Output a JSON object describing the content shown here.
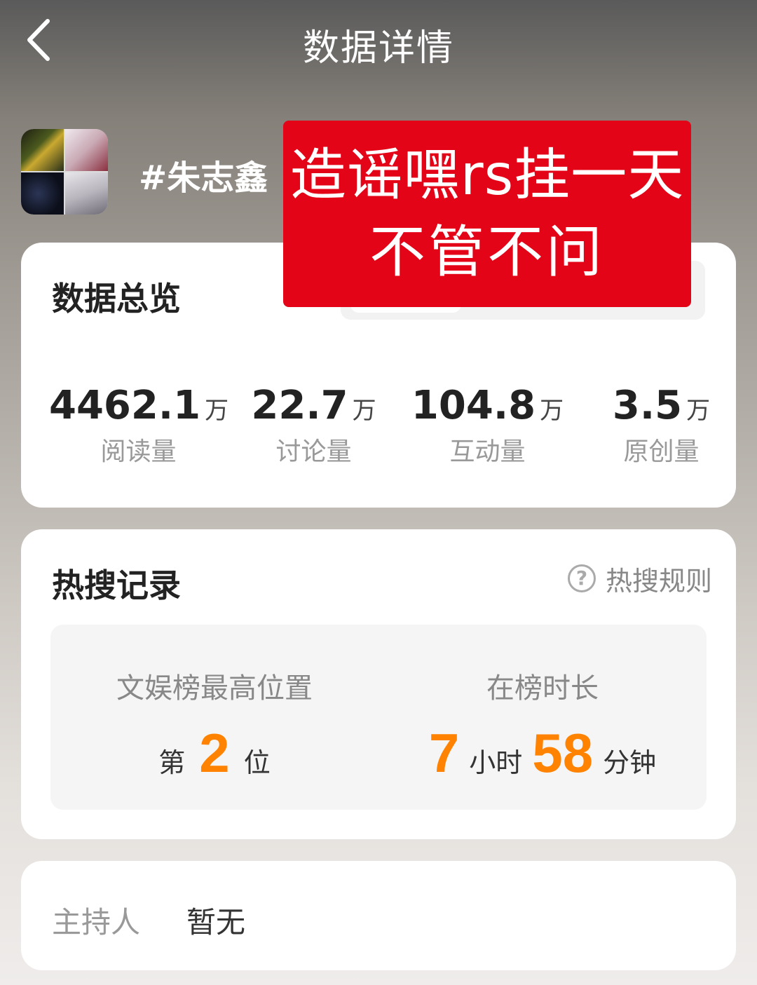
{
  "header": {
    "title": "数据详情"
  },
  "topic": {
    "name": "#朱志鑫"
  },
  "overlay": {
    "line1": "造谣嘿rs挂一天",
    "line2": "不管不问"
  },
  "overview": {
    "title": "数据总览",
    "stats": [
      {
        "value": "4462.1",
        "unit": "万",
        "label": "阅读量"
      },
      {
        "value": "22.7",
        "unit": "万",
        "label": "讨论量"
      },
      {
        "value": "104.8",
        "unit": "万",
        "label": "互动量"
      },
      {
        "value": "3.5",
        "unit": "万",
        "label": "原创量"
      }
    ]
  },
  "hot_search": {
    "title": "热搜记录",
    "rule_icon": "?",
    "rule_label": "热搜规则",
    "best_rank": {
      "label": "文娱榜最高位置",
      "prefix": "第",
      "value": "2",
      "suffix": "位"
    },
    "duration": {
      "label": "在榜时长",
      "hours": "7",
      "hours_unit": "小时",
      "minutes": "58",
      "minutes_unit": "分钟"
    }
  },
  "host": {
    "label": "主持人",
    "value": "暂无"
  },
  "colors": {
    "accent": "#ff8200",
    "overlay_red": "#e30418"
  },
  "icons": {
    "back": "chevron-left-icon",
    "help": "question-circle-icon"
  }
}
